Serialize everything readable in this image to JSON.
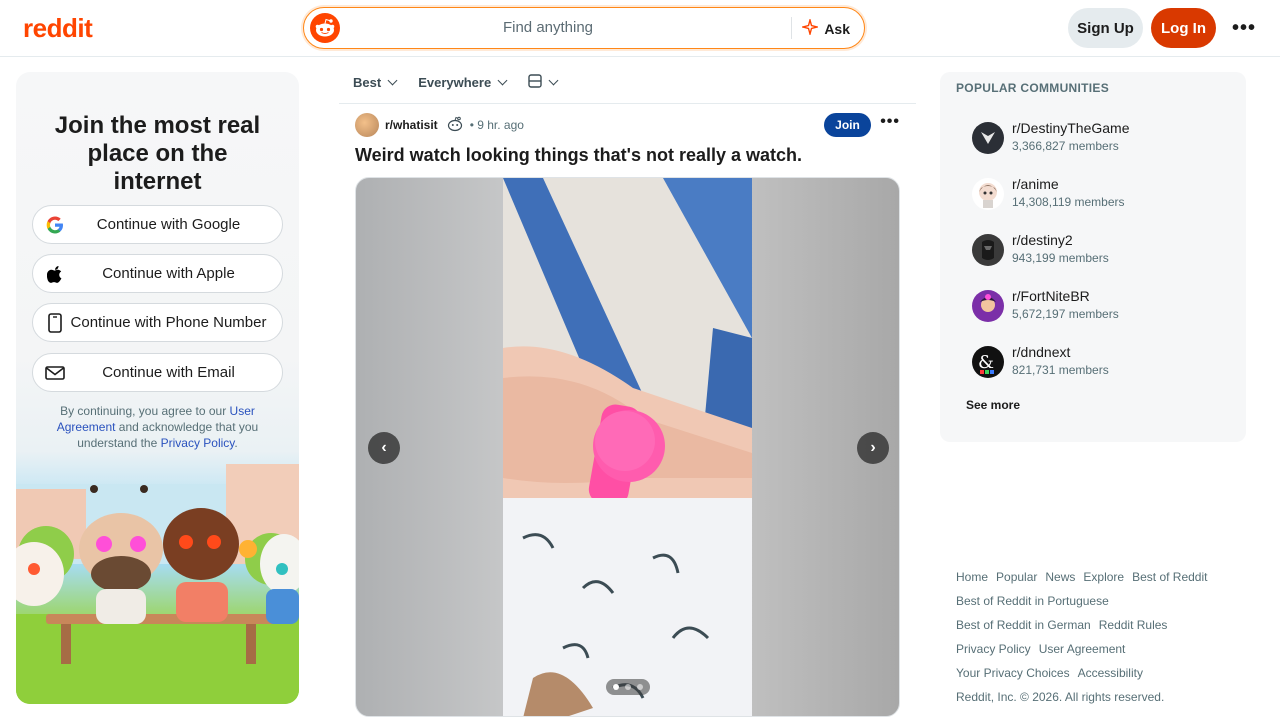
{
  "header": {
    "logo": "reddit",
    "search_placeholder": "Find anything",
    "ask_label": "Ask",
    "signup_label": "Sign Up",
    "login_label": "Log In",
    "more_label": "•••"
  },
  "join": {
    "title": "Join the most real place on the internet",
    "buttons": [
      {
        "label": "Continue with Google",
        "icon": "google-icon"
      },
      {
        "label": "Continue with Apple",
        "icon": "apple-icon"
      },
      {
        "label": "Continue with Phone Number",
        "icon": "phone-icon"
      },
      {
        "label": "Continue with Email",
        "icon": "mail-icon"
      }
    ],
    "terms_prefix": "By continuing, you agree to our ",
    "terms_link1": "User Agreement",
    "terms_middle": " and acknowledge that you understand the ",
    "terms_link2": "Privacy Policy",
    "terms_suffix": "."
  },
  "feed": {
    "sort": [
      "Best",
      "Everywhere"
    ],
    "post": {
      "subreddit": "r/whatisit",
      "time": "• 9 hr. ago",
      "join_label": "Join",
      "more_label": "•••",
      "title": "Weird watch looking things that's not really a watch.",
      "gallery_count": 3,
      "gallery_index": 1
    }
  },
  "sidebar": {
    "title": "POPULAR COMMUNITIES",
    "communities": [
      {
        "name": "r/DestinyTheGame",
        "members": "3,366,827 members",
        "color": "#2b2f36"
      },
      {
        "name": "r/anime",
        "members": "14,308,119 members",
        "color": "#e9e4e4"
      },
      {
        "name": "r/destiny2",
        "members": "943,199 members",
        "color": "#3a3a3a"
      },
      {
        "name": "r/FortNiteBR",
        "members": "5,672,197 members",
        "color": "#7b2fa8"
      },
      {
        "name": "r/dndnext",
        "members": "821,731 members",
        "color": "#111111"
      }
    ],
    "see_more": "See more"
  },
  "footer": {
    "links": [
      "Home",
      "Popular",
      "News",
      "Explore",
      "Best of Reddit"
    ],
    "row2": "Best of Reddit in Portuguese",
    "row3a": "Best of Reddit in German",
    "row3b": "Reddit Rules",
    "row4a": "Privacy Policy",
    "row4b": "User Agreement",
    "row5a": "Your Privacy Choices",
    "row5b": "Accessibility",
    "copyright": "Reddit, Inc. © 2026. All rights reserved."
  },
  "colors": {
    "brand": "#ff4500",
    "login": "#d93900",
    "join": "#0a449b"
  }
}
